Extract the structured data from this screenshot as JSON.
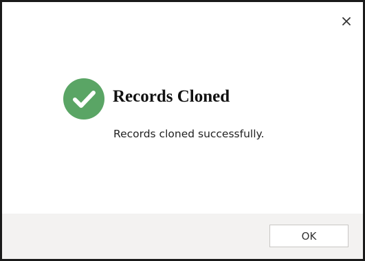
{
  "dialog": {
    "title": "Records Cloned",
    "message": "Records cloned successfully.",
    "ok_label": "OK",
    "close_icon": "close-icon",
    "status_icon": "success-check-icon",
    "colors": {
      "success": "#5aa565",
      "footer": "#f3f2f1",
      "border": "#1a1a1a"
    }
  }
}
